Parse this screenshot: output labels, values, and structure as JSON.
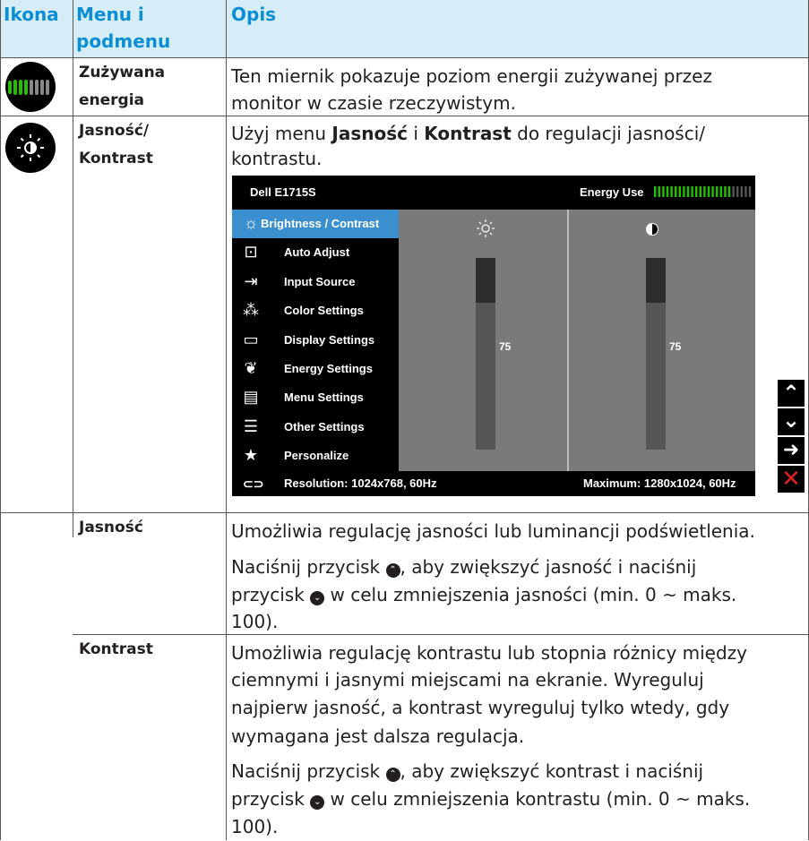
{
  "header": {
    "col1": "Ikona",
    "col2": "Menu i",
    "col2b": "podmenu",
    "col3": "Opis"
  },
  "rows": {
    "energy": {
      "menu1": "Zużywana",
      "menu2": "energia",
      "desc1": "Ten miernik pokazuje poziom energii zużywanej przez",
      "desc2": "monitor w czasie rzeczywistym."
    },
    "brightness": {
      "menu1": "Jasność/",
      "menu2": "Kontrast",
      "desc1a": "Użyj menu ",
      "desc1b": "Jasność",
      "desc1c": " i ",
      "desc1d": "Kontrast",
      "desc1e": " do regulacji jasności/",
      "desc2": "kontrastu."
    },
    "jasnosc": {
      "menu": "Jasność",
      "l1": "Umożliwia regulację jasności lub luminancji podświetlenia.",
      "l2a": "Naciśnij przycisk ",
      "l2b": ", aby zwiększyć jasność i naciśnij",
      "l3a": "przycisk ",
      "l3b": " w celu zmniejszenia jasności (min. 0 ~ maks.",
      "l4": "100)."
    },
    "kontrast": {
      "menu": "Kontrast",
      "l1": "Umożliwia regulację kontrastu lub stopnia różnicy między",
      "l2": "ciemnymi i jasnymi miejscami na ekranie. Wyreguluj",
      "l3": "najpierw jasność, a kontrast wyreguluj tylko wtedy, gdy",
      "l4": "wymagana jest dalsza regulacja.",
      "l5a": "Naciśnij przycisk ",
      "l5b": ", aby zwiększyć kontrast i naciśnij",
      "l6a": "przycisk ",
      "l6b": " w celu zmniejszenia kontrastu (min. 0 ~ maks.",
      "l7": "100)."
    }
  },
  "osd": {
    "model": "Dell E1715S",
    "energy_label": "Energy Use",
    "energy_level": 0.8,
    "menu": [
      {
        "label": "Brightness / Contrast",
        "icon": "brightness-icon",
        "selected": true
      },
      {
        "label": "Auto Adjust",
        "icon": "auto-adjust-icon"
      },
      {
        "label": "Input Source",
        "icon": "input-source-icon"
      },
      {
        "label": "Color Settings",
        "icon": "color-settings-icon"
      },
      {
        "label": "Display Settings",
        "icon": "display-settings-icon"
      },
      {
        "label": "Energy Settings",
        "icon": "energy-settings-icon"
      },
      {
        "label": "Menu Settings",
        "icon": "menu-settings-icon"
      },
      {
        "label": "Other Settings",
        "icon": "other-settings-icon"
      },
      {
        "label": "Personalize",
        "icon": "star-icon"
      }
    ],
    "brightness_value": "75",
    "contrast_value": "75",
    "resolution": "Resolution: 1024x768, 60Hz",
    "maximum": "Maximum: 1280x1024, 60Hz"
  },
  "nav_buttons": [
    "up-icon",
    "down-icon",
    "enter-icon",
    "exit-icon"
  ],
  "colors": {
    "header_bg": "#d6ecf6",
    "header_text": "#0a8fd4",
    "osd_selected": "#3b8fcf",
    "meter_green": "#22c000"
  }
}
